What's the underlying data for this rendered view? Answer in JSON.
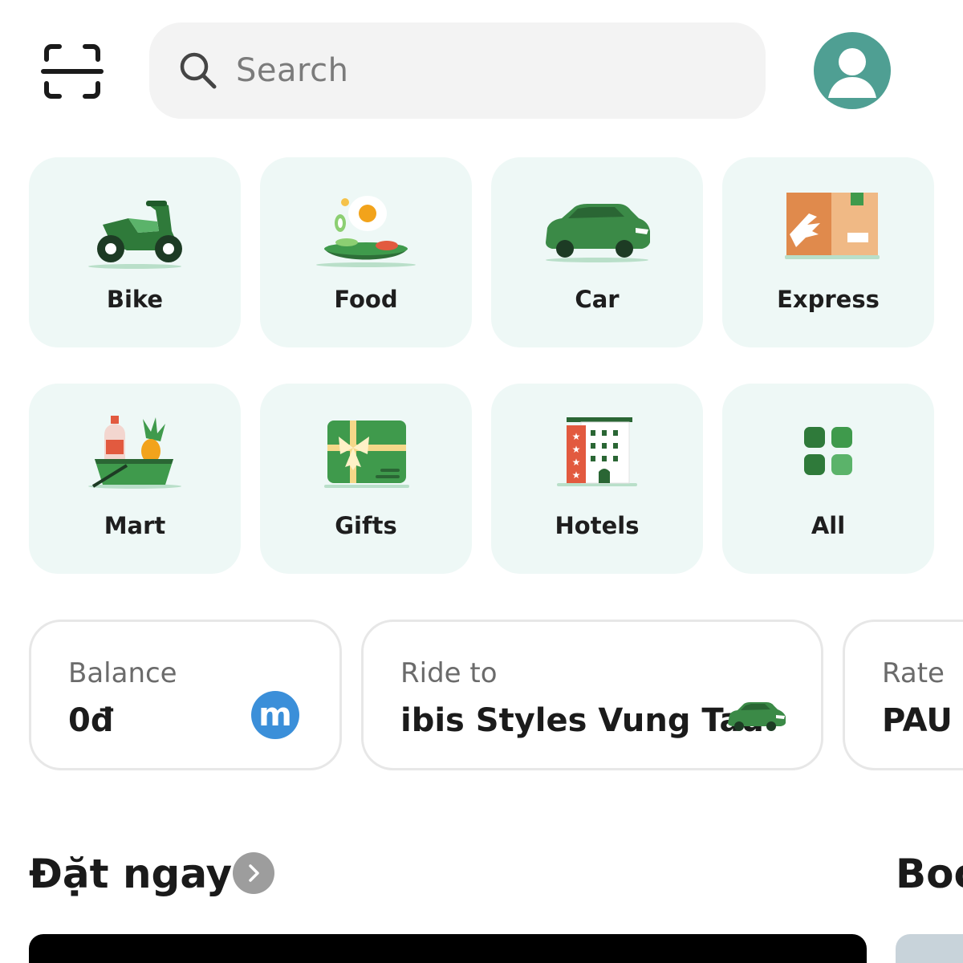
{
  "header": {
    "scan_icon": "scan-icon",
    "search": {
      "placeholder": "Search",
      "icon": "search-icon"
    },
    "avatar_icon": "user-icon",
    "avatar_color": "#4f9f93"
  },
  "services": [
    {
      "label": "Bike",
      "icon": "motorbike-icon"
    },
    {
      "label": "Food",
      "icon": "food-plate-icon"
    },
    {
      "label": "Car",
      "icon": "car-icon"
    },
    {
      "label": "Express",
      "icon": "package-icon"
    },
    {
      "label": "Mart",
      "icon": "grocery-basket-icon"
    },
    {
      "label": "Gifts",
      "icon": "gift-card-icon"
    },
    {
      "label": "Hotels",
      "icon": "hotel-icon"
    },
    {
      "label": "All",
      "icon": "grid-icon"
    }
  ],
  "cards": {
    "balance": {
      "caption": "Balance",
      "value": "0đ",
      "badge": "m"
    },
    "ride": {
      "caption": "Ride to",
      "value": "ibis Styles Vung Tau"
    },
    "rate": {
      "caption": "Rate",
      "value": "PAU -"
    }
  },
  "sections": {
    "primary_title": "Đặt ngay",
    "secondary_title": "Boo"
  },
  "colors": {
    "tile_bg": "#eef8f6",
    "brand_green": "#3f9a4c",
    "badge_blue": "#3b8fd9"
  }
}
